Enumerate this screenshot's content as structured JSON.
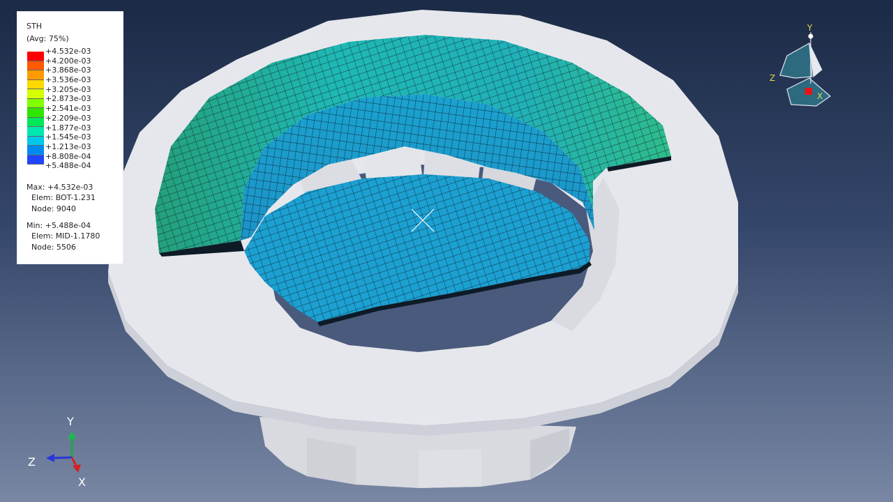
{
  "legend": {
    "title": "STH",
    "subtitle": "(Avg: 75%)",
    "levels": [
      {
        "label": "+4.532e-03",
        "color": "#ff0000"
      },
      {
        "label": "+4.200e-03",
        "color": "#ff5a00"
      },
      {
        "label": "+3.868e-03",
        "color": "#ff9a00"
      },
      {
        "label": "+3.536e-03",
        "color": "#ffd800"
      },
      {
        "label": "+3.205e-03",
        "color": "#d6ff00"
      },
      {
        "label": "+2.873e-03",
        "color": "#82ff00"
      },
      {
        "label": "+2.541e-03",
        "color": "#2ee600"
      },
      {
        "label": "+2.209e-03",
        "color": "#00e85a"
      },
      {
        "label": "+1.877e-03",
        "color": "#00e8b0"
      },
      {
        "label": "+1.545e-03",
        "color": "#00c8ea"
      },
      {
        "label": "+1.213e-03",
        "color": "#008af0"
      },
      {
        "label": "+8.808e-04",
        "color": "#1f45ff"
      },
      {
        "label": "+5.488e-04",
        "color": "#0000ff"
      }
    ],
    "max_line": "Max: +4.532e-03",
    "max_elem": "Elem: BOT-1.231",
    "max_node": "Node: 9040",
    "min_line": "Min: +5.488e-04",
    "min_elem": "Elem: MID-1.1780",
    "min_node": "Node: 5506"
  },
  "view_cube": {
    "y": "Y",
    "z": "Z",
    "x": "X"
  },
  "triad": {
    "y": "Y",
    "z": "Z",
    "x": "X"
  },
  "colors": {
    "ring": "#e6e7ec",
    "mesh_blue": "#1ea4d6",
    "mesh_cyan": "#1fb8b4",
    "mesh_green": "#2ec67a",
    "mesh_lines": "#0d1c2a"
  }
}
